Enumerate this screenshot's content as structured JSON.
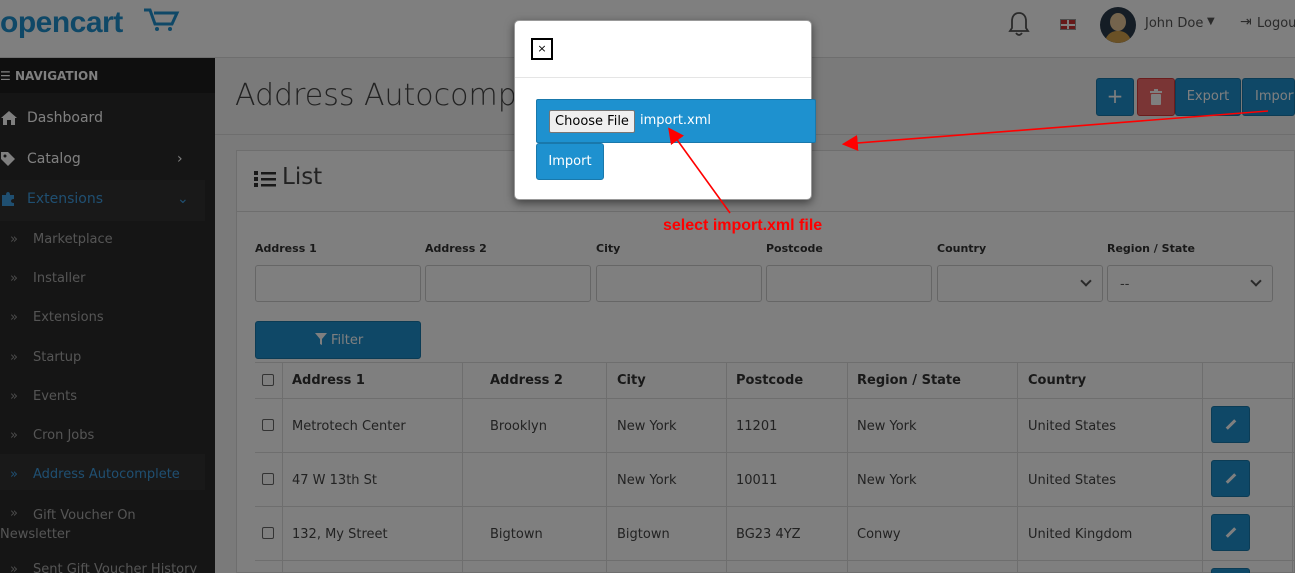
{
  "header": {
    "logo": "opencart",
    "user_name": "John Doe",
    "logout_label": "Logout"
  },
  "sidebar": {
    "nav_title": "NAVIGATION",
    "items": [
      {
        "label": "Dashboard",
        "icon": "home-icon"
      },
      {
        "label": "Catalog",
        "icon": "tag-icon"
      },
      {
        "label": "Extensions",
        "icon": "puzzle-icon"
      }
    ],
    "sub_items": [
      "Marketplace",
      "Installer",
      "Extensions",
      "Startup",
      "Events",
      "Cron Jobs",
      "Address Autocomplete",
      "Gift Voucher On Newsletter",
      "Sent Gift Voucher History"
    ]
  },
  "page": {
    "title": "Address Autocomplete",
    "export_label": "Export",
    "import_label": "Import"
  },
  "panel": {
    "title": "List",
    "filters": {
      "address1_label": "Address 1",
      "address2_label": "Address 2",
      "city_label": "City",
      "postcode_label": "Postcode",
      "country_label": "Country",
      "region_label": "Region / State",
      "region_value": "--"
    },
    "filter_button": "Filter",
    "columns": [
      "Address 1",
      "Address 2",
      "City",
      "Postcode",
      "Region / State",
      "Country"
    ],
    "rows": [
      {
        "address1": "Metrotech Center",
        "address2": "Brooklyn",
        "city": "New York",
        "postcode": "11201",
        "region": "New York",
        "country": "United States"
      },
      {
        "address1": "47 W 13th St",
        "address2": "",
        "city": "New York",
        "postcode": "10011",
        "region": "New York",
        "country": "United States"
      },
      {
        "address1": "132, My Street",
        "address2": "Bigtown",
        "city": "Bigtown",
        "postcode": "BG23 4YZ",
        "region": "Conwy",
        "country": "United Kingdom"
      }
    ]
  },
  "modal": {
    "close_label": "×",
    "choose_file_label": "Choose File",
    "file_name": "import.xml",
    "import_label": "Import"
  },
  "annotation": {
    "text": "select import.xml file",
    "color": "#ff0000"
  },
  "colors": {
    "primary": "#1e91cf",
    "danger": "#f56b6b",
    "sidebar": "#2b2b2b",
    "link_active": "#3f9ee3"
  }
}
